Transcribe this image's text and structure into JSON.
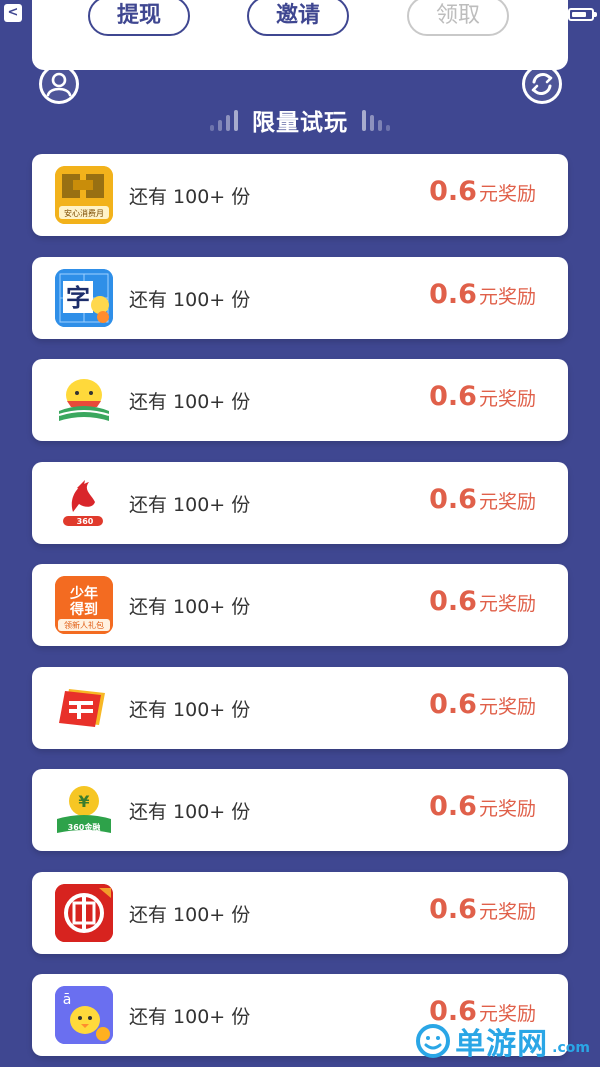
{
  "status_bar": {
    "back": "<"
  },
  "top_card": {
    "buttons": [
      {
        "label": "提现",
        "state": "active"
      },
      {
        "label": "邀请",
        "state": "active"
      },
      {
        "label": "领取",
        "state": "disabled"
      }
    ]
  },
  "section": {
    "title": "限量试玩"
  },
  "items": [
    {
      "icon": "consumer-app-icon",
      "icon_text": "安心消费月",
      "remain_text": "还有 100+ 份",
      "amount": "0.6",
      "unit": "元奖励"
    },
    {
      "icon": "word-learning-app-icon",
      "icon_text": "字",
      "remain_text": "还有 100+ 份",
      "amount": "0.6",
      "unit": "元奖励"
    },
    {
      "icon": "chick-book-app-icon",
      "remain_text": "还有 100+ 份",
      "amount": "0.6",
      "unit": "元奖励"
    },
    {
      "icon": "360-browser-app-icon",
      "icon_text": "360",
      "remain_text": "还有 100+ 份",
      "amount": "0.6",
      "unit": "元奖励"
    },
    {
      "icon": "young-dedao-app-icon",
      "icon_text": "少年\n得到",
      "icon_sub": "领新人礼包",
      "remain_text": "还有 100+ 份",
      "amount": "0.6",
      "unit": "元奖励"
    },
    {
      "icon": "post-bank-app-icon",
      "remain_text": "还有 100+ 份",
      "amount": "0.6",
      "unit": "元奖励"
    },
    {
      "icon": "360-finance-app-icon",
      "icon_text": "360金融",
      "remain_text": "还有 100+ 份",
      "amount": "0.6",
      "unit": "元奖励"
    },
    {
      "icon": "citic-bank-app-icon",
      "remain_text": "还有 100+ 份",
      "amount": "0.6",
      "unit": "元奖励"
    },
    {
      "icon": "chick-pinyin-app-icon",
      "icon_text": "ā",
      "remain_text": "还有 100+ 份",
      "amount": "0.6",
      "unit": "元奖励"
    }
  ],
  "watermark": {
    "text": "单游网",
    "sub": ".com"
  },
  "colors": {
    "background": "#3f4791",
    "card": "#ffffff",
    "reward": "#e0604a",
    "primary_text": "#333333",
    "watermark": "#2aa6e6"
  }
}
